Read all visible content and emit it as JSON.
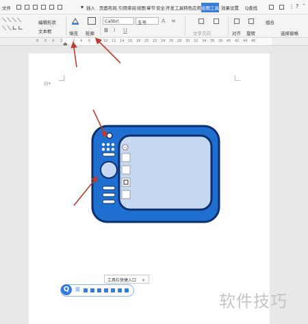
{
  "titlebar": {
    "file": "文件",
    "tabs": [
      "插入",
      "页面布局",
      "引用",
      "审阅",
      "视图",
      "章节",
      "安全",
      "开发工具",
      "特色应用"
    ],
    "active_tab": "绘图工具",
    "effect_tab": "效果设置",
    "search": "Q查找"
  },
  "ribbon": {
    "edit_shape": "编辑形状",
    "text_box": "文本框",
    "fill": "填充",
    "outline": "轮廓",
    "font": "Calibri",
    "font_size": "五号",
    "align": "对齐",
    "rotate": "旋转",
    "group": "组合",
    "select_pane": "选择窗格",
    "text_dir": "文字方向"
  },
  "ruler": {
    "ticks": [
      "8",
      "6",
      "4",
      "2",
      "2",
      "4",
      "6",
      "8",
      "10",
      "12",
      "14",
      "16",
      "18",
      "20",
      "22",
      "24",
      "26",
      "28",
      "30",
      "32",
      "34",
      "36",
      "38",
      "40",
      "42",
      "44",
      "46"
    ]
  },
  "floating": {
    "tooltip": "工具栏快捷入口",
    "close": "✕",
    "q_label": "Q",
    "fan": "简"
  },
  "watermark": "软件技巧",
  "colors": {
    "device_body": "#1f6fd1",
    "device_border": "#0a2f6e",
    "screen_fill": "#c6d8f2",
    "arrow": "#c0392b"
  }
}
